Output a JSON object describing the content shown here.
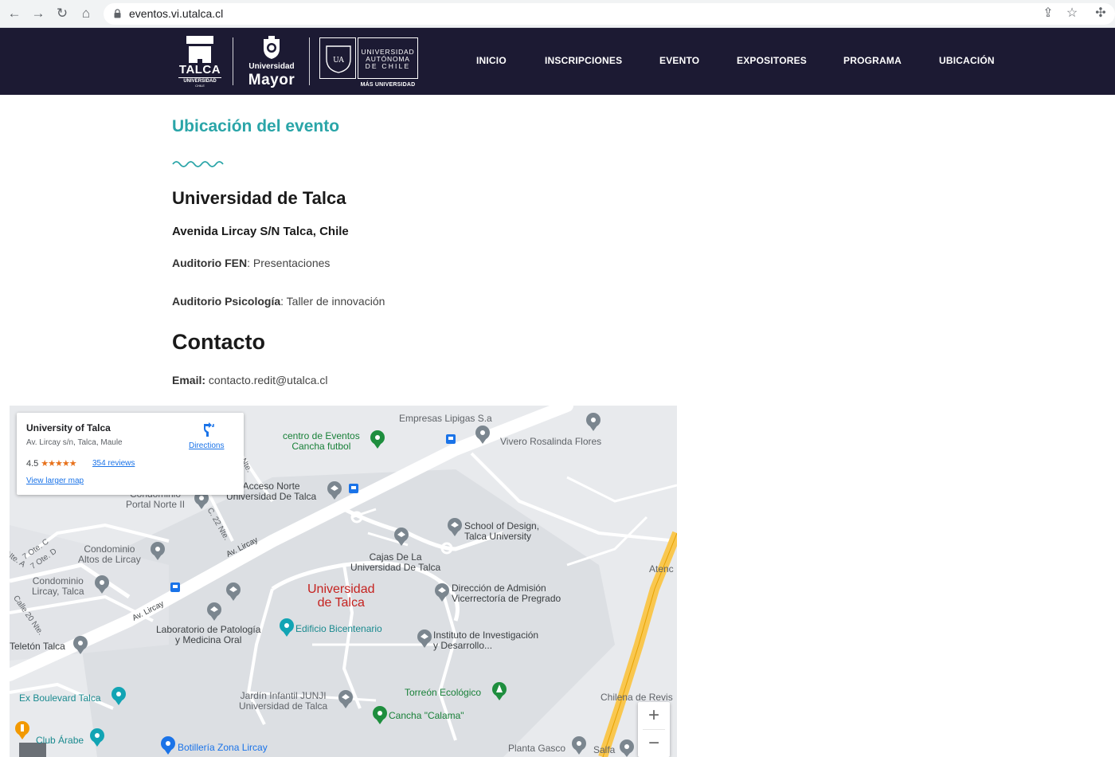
{
  "browser": {
    "url": "eventos.vi.utalca.cl"
  },
  "logos": {
    "talca": {
      "line1": "TALCA",
      "line2": "UNIVERSIDAD",
      "line3": "CHILE"
    },
    "mayor": {
      "line1": "Universidad",
      "line2": "Mayor"
    },
    "autonoma": {
      "line1": "UNIVERSIDAD",
      "line2": "AUTÓNOMA",
      "line3": "DE CHILE",
      "tagline": "MÁS UNIVERSIDAD",
      "shield": "UA"
    }
  },
  "nav": {
    "inicio": "INICIO",
    "inscripciones": "INSCRIPCIONES",
    "evento": "EVENTO",
    "expositores": "EXPOSITORES",
    "programa": "PROGRAMA",
    "ubicacion": "UBICACIÓN"
  },
  "content": {
    "section_title": "Ubicación del evento",
    "place_name": "Universidad de Talca",
    "address": "Avenida Lircay S/N Talca, Chile",
    "room1_label": "Auditorio FEN",
    "room1_value": ": Presentaciones",
    "room2_label": "Auditorio Psicología",
    "room2_value": ": Taller de innovación",
    "contact_title": "Contacto",
    "email_label": "Email:",
    "email_value": " contacto.redit@utalca.cl"
  },
  "map": {
    "card": {
      "name": "University of Talca",
      "address": "Av. Lircay s/n, Talca, Maule",
      "rating": "4.5",
      "stars": "★★★★★",
      "reviews": "354 reviews",
      "larger": "View larger map",
      "directions": "Directions"
    },
    "labels": {
      "empresas": "Empresas Lipigas S.a",
      "centro_eventos": "centro de Eventos\nCancha futbol",
      "vivero": "Vivero Rosalinda Flores",
      "acceso_norte": "Acceso Norte\nUniversidad De Talca",
      "portal_norte": "Condominio\nPortal Norte II",
      "c22": "C. 22 Nte.",
      "nte": "Nte.",
      "school_design": "School of Design,\nTalca University",
      "condominio_altos": "Condominio\nAltos de Lircay",
      "ote_c": "7 Ote. C",
      "ote_d": "7 Ote. D",
      "nte_a": "Nte. A",
      "av_lircay_1": "Av. Lircay",
      "av_lircay_2": "Av. Lircay",
      "cajas": "Cajas De La\nUniversidad De Talca",
      "atenc": "Atenc",
      "condominio_lircay": "Condominio\nLircay, Talca",
      "universidad": "Universidad\nde Talca",
      "direccion": "Dirección de Admisión\nVicerrectoría de Pregrado",
      "calle20": "Calle 20 Nte.",
      "laboratorio": "Laboratorio de Patología\ny Medicina Oral",
      "edificio": "Edificio Bicentenario",
      "instituto": "Instituto de Investigación\ny Desarrollo...",
      "teleton": "Teletón Talca",
      "torreon": "Torreón Ecológico",
      "jardin": "Jardín Infantil JUNJI\nUniversidad de Talca",
      "chilena": "Chilena de Revis",
      "ex_boulevard": "Ex Boulevard Talca",
      "cancha_calama": "Cancha \"Calama\"",
      "club_arabe": "Club Árabe",
      "botilleria": "Botillería Zona Lircay",
      "planta_gasco": "Planta Gasco",
      "salfa": "Salfa",
      "zoom_in": "+",
      "zoom_out": "−"
    }
  },
  "colors": {
    "header_bg": "#1c1a33",
    "accent": "#2aa5a8",
    "map_bg": "#e8eaed",
    "map_road": "#ffffff",
    "map_highway": "#f9c74f",
    "pin_gray": "#7b868f",
    "pin_green": "#1e8e3e"
  }
}
